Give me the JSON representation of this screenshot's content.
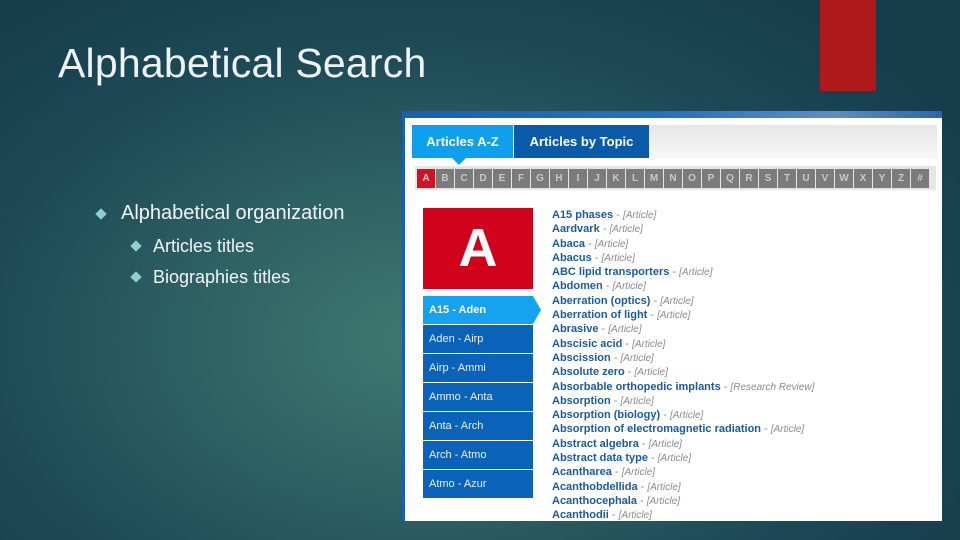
{
  "slide": {
    "title": "Alphabetical Search",
    "bullets": [
      {
        "level": 1,
        "text": "Alphabetical organization"
      },
      {
        "level": 2,
        "text": "Articles titles"
      },
      {
        "level": 2,
        "text": "Biographies titles"
      }
    ],
    "accent_color": "#b0191a"
  },
  "screenshot": {
    "tabs": [
      {
        "label": "Articles A-Z",
        "active": true
      },
      {
        "label": "Articles by Topic",
        "active": false
      }
    ],
    "letters": [
      "A",
      "B",
      "C",
      "D",
      "E",
      "F",
      "G",
      "H",
      "I",
      "J",
      "K",
      "L",
      "M",
      "N",
      "O",
      "P",
      "Q",
      "R",
      "S",
      "T",
      "U",
      "V",
      "W",
      "X",
      "Y",
      "Z",
      "#"
    ],
    "active_letter": "A",
    "big_letter": "A",
    "ranges": [
      {
        "label": "A15 - Aden",
        "active": true
      },
      {
        "label": "Aden - Airp",
        "active": false
      },
      {
        "label": "Airp - Ammi",
        "active": false
      },
      {
        "label": "Ammo - Anta",
        "active": false
      },
      {
        "label": "Anta - Arch",
        "active": false
      },
      {
        "label": "Arch - Atmo",
        "active": false
      },
      {
        "label": "Atmo - Azur",
        "active": false
      }
    ],
    "articles": [
      {
        "name": "A15 phases",
        "type": "[Article]"
      },
      {
        "name": "Aardvark",
        "type": "[Article]"
      },
      {
        "name": "Abaca",
        "type": "[Article]"
      },
      {
        "name": "Abacus",
        "type": "[Article]"
      },
      {
        "name": "ABC lipid transporters",
        "type": "[Article]"
      },
      {
        "name": "Abdomen",
        "type": "[Article]"
      },
      {
        "name": "Aberration (optics)",
        "type": "[Article]"
      },
      {
        "name": "Aberration of light",
        "type": "[Article]"
      },
      {
        "name": "Abrasive",
        "type": "[Article]"
      },
      {
        "name": "Abscisic acid",
        "type": "[Article]"
      },
      {
        "name": "Abscission",
        "type": "[Article]"
      },
      {
        "name": "Absolute zero",
        "type": "[Article]"
      },
      {
        "name": "Absorbable orthopedic implants",
        "type": "[Research Review]"
      },
      {
        "name": "Absorption",
        "type": "[Article]"
      },
      {
        "name": "Absorption (biology)",
        "type": "[Article]"
      },
      {
        "name": "Absorption of electromagnetic radiation",
        "type": "[Article]"
      },
      {
        "name": "Abstract algebra",
        "type": "[Article]"
      },
      {
        "name": "Abstract data type",
        "type": "[Article]"
      },
      {
        "name": "Acantharea",
        "type": "[Article]"
      },
      {
        "name": "Acanthobdellida",
        "type": "[Article]"
      },
      {
        "name": "Acanthocephala",
        "type": "[Article]"
      },
      {
        "name": "Acanthodii",
        "type": "[Article]"
      }
    ],
    "separator": " - ",
    "colors": {
      "tab_active": "#0ea0ea",
      "tab_inactive": "#0a5aa8",
      "letter_active": "#d01223",
      "letter_inactive": "#7b7b7b",
      "range_active": "#15a3f0",
      "range_inactive": "#0a63b8",
      "article_link": "#1a5aa4"
    }
  }
}
